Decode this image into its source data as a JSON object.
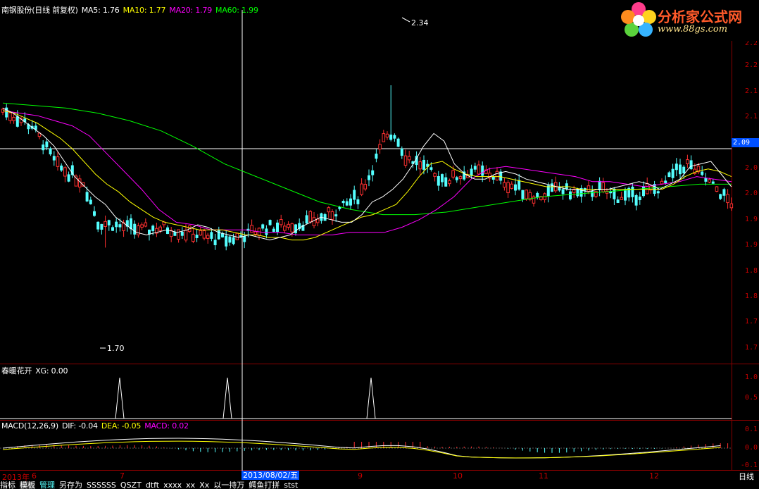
{
  "main_legend": {
    "title": "南钢股份(日线 前复权)",
    "ma5": "MA5: 1.76",
    "ma10": "MA10: 1.77",
    "ma20": "MA20: 1.79",
    "ma60": "MA60: 1.99"
  },
  "ind1_legend": {
    "title": "春暖花开",
    "xg": "XG: 0.00"
  },
  "macd_legend": {
    "title": "MACD(12,26,9)",
    "dif": "DIF: -0.04",
    "dea": "DEA: -0.05",
    "macd": "MACD: 0.02"
  },
  "price_axis": [
    "2.2",
    "2.2",
    "2.1",
    "2.1",
    "2.0",
    "2.0",
    "1.9",
    "1.9",
    "1.8",
    "1.8",
    "1.7",
    "1.7"
  ],
  "ind1_axis": [
    "1.0",
    "0.5"
  ],
  "macd_axis": [
    "0.1",
    "0.0",
    "-0.1"
  ],
  "current_price": "2.09",
  "high_label": "2.34",
  "low_label": "1.70",
  "x_labels": [
    "2013年",
    "6",
    "7",
    "9",
    "10",
    "11",
    "12"
  ],
  "cursor_date": "2013/08/02/五",
  "period": "日线",
  "bottom_tabs": [
    "指标",
    "模板",
    "管理",
    "另存为",
    "SSSSSS",
    "QSZT",
    "dtft",
    "xxxx",
    "xx",
    "Xx",
    "以一持万",
    "鳄鱼打拼",
    "stst"
  ],
  "logo": {
    "title": "分析家公式网",
    "url": "www.88gs.com"
  },
  "colors": {
    "up": "#ff3030",
    "down": "#54ffff",
    "ma5": "#ffffff",
    "ma10": "#ffff00",
    "ma20": "#ff00ff",
    "ma60": "#00ff00",
    "axis": "#c80000",
    "cursor": "#0050ff"
  },
  "chart_data": {
    "type": "candlestick",
    "ma5": [
      2.25,
      2.23,
      2.2,
      2.17,
      2.14,
      2.1,
      2.04,
      1.98,
      1.94,
      1.9,
      1.87,
      1.82,
      1.79,
      1.76,
      1.75,
      1.76,
      1.77,
      1.76,
      1.77,
      1.79,
      1.78,
      1.76,
      1.75,
      1.74,
      1.75,
      1.74,
      1.73,
      1.74,
      1.75,
      1.78,
      1.8,
      1.82,
      1.81,
      1.8,
      1.8,
      1.83,
      1.88,
      1.9,
      1.93,
      1.97,
      2.03,
      2.1,
      2.15,
      2.12,
      2.03,
      1.99,
      1.97,
      1.97,
      1.99,
      2.0,
      1.99,
      1.97,
      1.96,
      1.95,
      1.94,
      1.93,
      1.93,
      1.92,
      1.93,
      1.93,
      1.94,
      1.95,
      1.96,
      1.95,
      1.93,
      1.95,
      1.97,
      2.02,
      2.03,
      2.04,
      1.99,
      1.94
    ],
    "ma10": [
      2.24,
      2.23,
      2.21,
      2.19,
      2.16,
      2.13,
      2.09,
      2.04,
      1.99,
      1.95,
      1.92,
      1.88,
      1.85,
      1.82,
      1.8,
      1.79,
      1.78,
      1.77,
      1.77,
      1.77,
      1.76,
      1.75,
      1.75,
      1.74,
      1.74,
      1.73,
      1.73,
      1.74,
      1.76,
      1.78,
      1.8,
      1.82,
      1.83,
      1.85,
      1.87,
      1.92,
      1.98,
      2.03,
      2.04,
      2.01,
      1.99,
      1.98,
      1.98,
      1.98,
      1.97,
      1.96,
      1.95,
      1.94,
      1.94,
      1.94,
      1.93,
      1.93,
      1.93,
      1.93,
      1.93,
      1.93,
      1.93,
      1.93,
      1.95,
      1.98,
      2.0,
      2.01,
      2.0,
      1.98
    ],
    "ma20": [
      2.24,
      2.23,
      2.22,
      2.2,
      2.18,
      2.14,
      2.07,
      2.0,
      1.93,
      1.85,
      1.8,
      1.79,
      1.77,
      1.77,
      1.77,
      1.76,
      1.76,
      1.75,
      1.75,
      1.75,
      1.76,
      1.76,
      1.76,
      1.78,
      1.81,
      1.85,
      1.9,
      1.97,
      2.01,
      2.02,
      2.01,
      2.0,
      1.99,
      1.98,
      1.96,
      1.96,
      1.95,
      1.94,
      1.95,
      1.96,
      1.98,
      1.97,
      1.96
    ],
    "ma60": [
      2.27,
      2.26,
      2.25,
      2.23,
      2.2,
      2.16,
      2.1,
      2.03,
      1.98,
      1.93,
      1.88,
      1.85,
      1.83,
      1.83,
      1.84,
      1.86,
      1.88,
      1.9,
      1.91,
      1.92,
      1.93,
      1.94,
      1.95,
      1.95
    ],
    "xg_signals": [
      "2013-06",
      "2013-08-01",
      "2013-09"
    ],
    "high": 2.34,
    "low": 1.7,
    "current": 2.09
  }
}
